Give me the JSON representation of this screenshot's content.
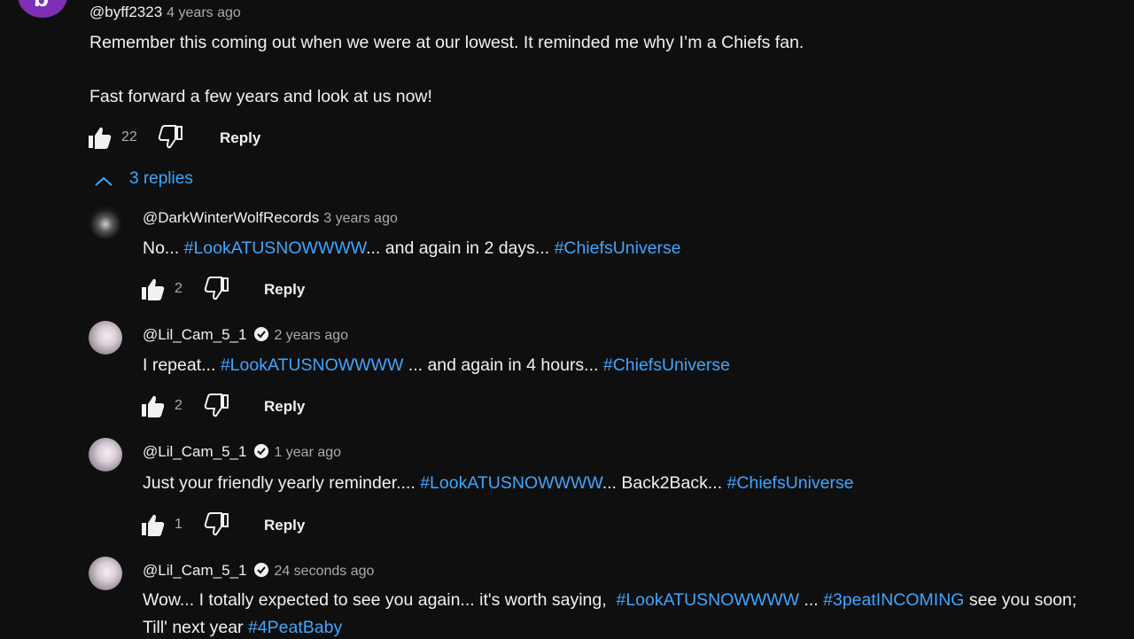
{
  "top_comment": {
    "avatar_letter": "b",
    "avatar_color": "#7d2fb5",
    "handle": "@byff2323",
    "time": "4 years ago",
    "line1": "Remember this coming out when we were at our lowest. It reminded me why I’m a Chiefs fan.",
    "line2": "Fast forward a few years and look at us now!",
    "likes": "22",
    "reply_label": "Reply"
  },
  "replies_toggle": {
    "label": "3 replies",
    "icon": "chevron-up-icon"
  },
  "replies": [
    {
      "handle": "@DarkWinterWolfRecords",
      "time": "3 years ago",
      "verified": false,
      "likes": "2",
      "reply_label": "Reply",
      "text": [
        {
          "t": "No... "
        },
        {
          "t": "#LookATUSNOWWWW",
          "tag": true
        },
        {
          "t": "... and again in 2 days... "
        },
        {
          "t": "#ChiefsUniverse",
          "tag": true
        }
      ]
    },
    {
      "handle": "@Lil_Cam_5_1",
      "time": "2 years ago",
      "verified": true,
      "likes": "2",
      "reply_label": "Reply",
      "text": [
        {
          "t": "I repeat... "
        },
        {
          "t": "#LookATUSNOWWWW",
          "tag": true
        },
        {
          "t": " ... and again in 4 hours... "
        },
        {
          "t": "#ChiefsUniverse",
          "tag": true
        }
      ]
    },
    {
      "handle": "@Lil_Cam_5_1",
      "time": "1 year ago",
      "verified": true,
      "likes": "1",
      "reply_label": "Reply",
      "text": [
        {
          "t": "Just your friendly yearly reminder.... "
        },
        {
          "t": "#LookATUSNOWWWW",
          "tag": true
        },
        {
          "t": "... Back2Back... "
        },
        {
          "t": "#ChiefsUniverse",
          "tag": true
        }
      ]
    },
    {
      "handle": "@Lil_Cam_5_1",
      "time": "24 seconds ago",
      "verified": true,
      "text": [
        {
          "t": "Wow... I totally expected to see you again... it's worth saying,  "
        },
        {
          "t": "#LookATUSNOWWWW",
          "tag": true
        },
        {
          "t": " ... "
        },
        {
          "t": "#3peatINCOMING",
          "tag": true
        },
        {
          "t": " see you soon;"
        }
      ],
      "text2": [
        {
          "t": "Till' next year "
        },
        {
          "t": "#4PeatBaby",
          "tag": true
        }
      ]
    }
  ],
  "colors": {
    "background": "#0f0f0f",
    "text": "#f1f1f1",
    "secondary": "#aaaaaa",
    "link": "#3ea6ff"
  }
}
